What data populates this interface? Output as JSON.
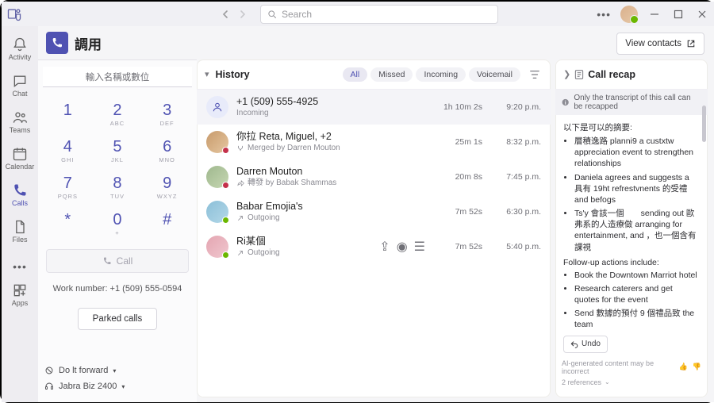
{
  "titlebar": {
    "search_placeholder": "Search",
    "back_icon": "chevron-left-icon",
    "fwd_icon": "chevron-right-icon"
  },
  "rail": [
    {
      "id": "activity",
      "label": "Activity"
    },
    {
      "id": "chat",
      "label": "Chat"
    },
    {
      "id": "teams",
      "label": "Teams"
    },
    {
      "id": "calendar",
      "label": "Calendar"
    },
    {
      "id": "calls",
      "label": "Calls"
    },
    {
      "id": "files",
      "label": "Files"
    }
  ],
  "rail_apps_label": "Apps",
  "dial": {
    "title": "調用",
    "name_placeholder": "輸入名稱或數位",
    "keys": [
      [
        "1",
        ""
      ],
      [
        "2",
        "ABC"
      ],
      [
        "3",
        "DEF"
      ],
      [
        "4",
        "GHI"
      ],
      [
        "5",
        "JKL"
      ],
      [
        "6",
        "MNO"
      ],
      [
        "7",
        "PQRS"
      ],
      [
        "8",
        "TUV"
      ],
      [
        "9",
        "WXYZ"
      ],
      [
        "*",
        ""
      ],
      [
        "0",
        "+"
      ],
      [
        "#",
        ""
      ]
    ],
    "call_label": "Call",
    "work_number": "Work number: +1 (509) 555-0594",
    "parked_label": "Parked calls",
    "forward_label": "Do lt forward",
    "device_label": "Jabra Biz 2400"
  },
  "top_right": {
    "view_contacts": "View contacts"
  },
  "history": {
    "title": "History",
    "filters": [
      "All",
      "Missed",
      "Incoming",
      "Voicemail"
    ],
    "active_filter": "All",
    "rows": [
      {
        "name": "+1 (509) 555-4925",
        "sub": "Incoming",
        "dur": "1h 10m 2s",
        "time": "9:20 p.m.",
        "kind": "incoming",
        "presence": ""
      },
      {
        "name": "你拉   Reta, Miguel, +2",
        "sub": "Merged by Darren Mouton",
        "dur": "25m 1s",
        "time": "8:32 p.m.",
        "kind": "av1",
        "presence": "r",
        "subicon": "merge"
      },
      {
        "name": "Darren Mouton",
        "sub": "轉發   by Babak Shammas",
        "dur": "20m 8s",
        "time": "7:45 p.m.",
        "kind": "av2",
        "presence": "r",
        "subicon": "fwd"
      },
      {
        "name": "Babar Emojia's",
        "sub": "Outgoing",
        "dur": "7m 52s",
        "time": "6:30 p.m.",
        "kind": "av3",
        "presence": "g",
        "subicon": "out"
      },
      {
        "name": "Ri某個",
        "sub": "Outgoing",
        "dur": "7m 52s",
        "time": "5:40 p.m.",
        "kind": "av4",
        "presence": "g",
        "subicon": "out",
        "extra_icons": true
      }
    ]
  },
  "recap": {
    "title": "Call recap",
    "notice": "Only the transcript of this call can be recapped",
    "intro": "以下是可以的摘要:",
    "bullets1": [
      "層積逸路 planni9 a custxtw appreciation event to strengthen relationships",
      "Daniela agrees and suggests a 具有 19ht refrestvnents 的受禮　 and befogs",
      "Ts'y 會該一個　　sending out 歐弗系的人造療做 arranging for entertainment, and ，也一個含有課視"
    ],
    "follow_label": "Follow-up actions include:",
    "bullets2": [
      "Book the Downtown Marriot hotel",
      "Research caterers and get quotes for the event",
      "Send 數據的預付 9 個禮品致 the team"
    ],
    "undo": "Undo",
    "ai_note": "AI-generated content may be incorrect",
    "refs": "2 references"
  }
}
